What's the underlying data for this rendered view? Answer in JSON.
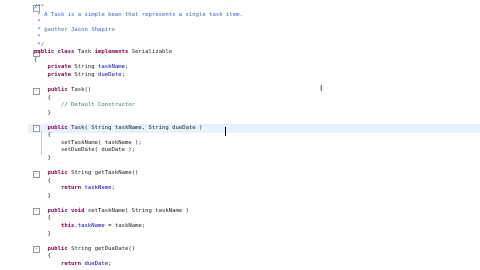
{
  "editor": {
    "lines": [
      [
        {
          "t": "/**",
          "c": "cm"
        }
      ],
      [
        {
          "t": " * A Task is a simple bean that represents a single task item.",
          "c": "cm"
        }
      ],
      [
        {
          "t": " *",
          "c": "cm"
        }
      ],
      [
        {
          "t": " * ",
          "c": "cm"
        },
        {
          "t": "@author",
          "c": "jt"
        },
        {
          "t": " Jason Shapiro",
          "c": "cm"
        }
      ],
      [
        {
          "t": " *",
          "c": "cm"
        }
      ],
      [
        {
          "t": " */",
          "c": "cm"
        }
      ],
      [
        {
          "t": "public class",
          "c": "kw"
        },
        {
          "t": " Task "
        },
        {
          "t": "implements",
          "c": "kw"
        },
        {
          "t": " Serializable"
        }
      ],
      [
        {
          "t": "{"
        }
      ],
      [
        {
          "t": "    "
        },
        {
          "t": "private",
          "c": "kw"
        },
        {
          "t": " String "
        },
        {
          "t": "taskName",
          "c": "fd"
        },
        {
          "t": ";"
        }
      ],
      [
        {
          "t": "    "
        },
        {
          "t": "private",
          "c": "kw"
        },
        {
          "t": " String "
        },
        {
          "t": "dueDate",
          "c": "fd"
        },
        {
          "t": ";"
        }
      ],
      [
        {
          "t": ""
        }
      ],
      [
        {
          "t": "    "
        },
        {
          "t": "public",
          "c": "kw"
        },
        {
          "t": " Task()"
        }
      ],
      [
        {
          "t": "    {"
        }
      ],
      [
        {
          "t": "        "
        },
        {
          "t": "// Default Constructor",
          "c": "cm2"
        }
      ],
      [
        {
          "t": "    }"
        }
      ],
      [
        {
          "t": ""
        }
      ],
      [
        {
          "t": "    "
        },
        {
          "t": "public",
          "c": "kw"
        },
        {
          "t": " Task( String taskName, String dueDate )"
        }
      ],
      [
        {
          "t": "    {"
        }
      ],
      [
        {
          "t": "        setTaskName( taskName );"
        }
      ],
      [
        {
          "t": "        setDueDate( dueDate );"
        }
      ],
      [
        {
          "t": "    }"
        }
      ],
      [
        {
          "t": ""
        }
      ],
      [
        {
          "t": "    "
        },
        {
          "t": "public",
          "c": "kw"
        },
        {
          "t": " String getTaskName()"
        }
      ],
      [
        {
          "t": "    {"
        }
      ],
      [
        {
          "t": "        "
        },
        {
          "t": "return",
          "c": "kw"
        },
        {
          "t": " "
        },
        {
          "t": "taskName",
          "c": "fd"
        },
        {
          "t": ";"
        }
      ],
      [
        {
          "t": "    }"
        }
      ],
      [
        {
          "t": ""
        }
      ],
      [
        {
          "t": "    "
        },
        {
          "t": "public void",
          "c": "kw"
        },
        {
          "t": " setTaskName( String taskName )"
        }
      ],
      [
        {
          "t": "    {"
        }
      ],
      [
        {
          "t": "        "
        },
        {
          "t": "this",
          "c": "kw"
        },
        {
          "t": "."
        },
        {
          "t": "taskName",
          "c": "fd"
        },
        {
          "t": " = taskName;"
        }
      ],
      [
        {
          "t": "    }"
        }
      ],
      [
        {
          "t": ""
        }
      ],
      [
        {
          "t": "    "
        },
        {
          "t": "public",
          "c": "kw"
        },
        {
          "t": " String getDueDate()"
        }
      ],
      [
        {
          "t": "    {"
        }
      ],
      [
        {
          "t": "        "
        },
        {
          "t": "return",
          "c": "kw"
        },
        {
          "t": " "
        },
        {
          "t": "dueDate",
          "c": "fd"
        },
        {
          "t": ";"
        }
      ]
    ]
  }
}
